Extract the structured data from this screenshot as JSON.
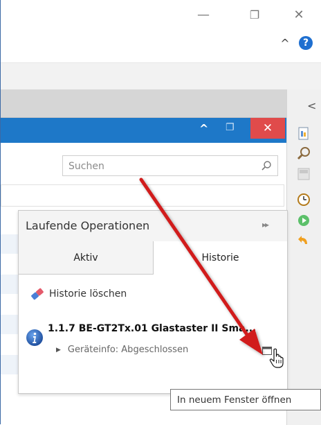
{
  "window": {
    "minimize_glyph": "—",
    "restore_glyph": "❐",
    "close_glyph": "✕",
    "collapse_glyph": "^",
    "help_glyph": "?"
  },
  "inner_window": {
    "up_glyph": "^",
    "restore_glyph": "❐",
    "close_glyph": "✕"
  },
  "right_panel": {
    "collapse_glyph": "<",
    "icons": [
      "document-icon",
      "search-icon",
      "layout-icon",
      "clock-icon",
      "play-icon",
      "undo-icon"
    ]
  },
  "search": {
    "placeholder": "Suchen"
  },
  "operations": {
    "title": "Laufende Operationen",
    "pin_glyph": "▸▸",
    "tabs": [
      {
        "label": "Aktiv",
        "active": false
      },
      {
        "label": "Historie",
        "active": true
      }
    ],
    "clear_history_label": "Historie löschen",
    "entry": {
      "title": "1.1.7 BE-GT2Tx.01 Glastaster II Sma...",
      "status": "Geräteinfo: Abgeschlossen"
    }
  },
  "tooltip": {
    "text": "In neuem Fenster öffnen"
  },
  "colors": {
    "title_blue": "#1e78c8",
    "close_red": "#e04b4b",
    "annotation_arrow": "#d11f1f"
  }
}
